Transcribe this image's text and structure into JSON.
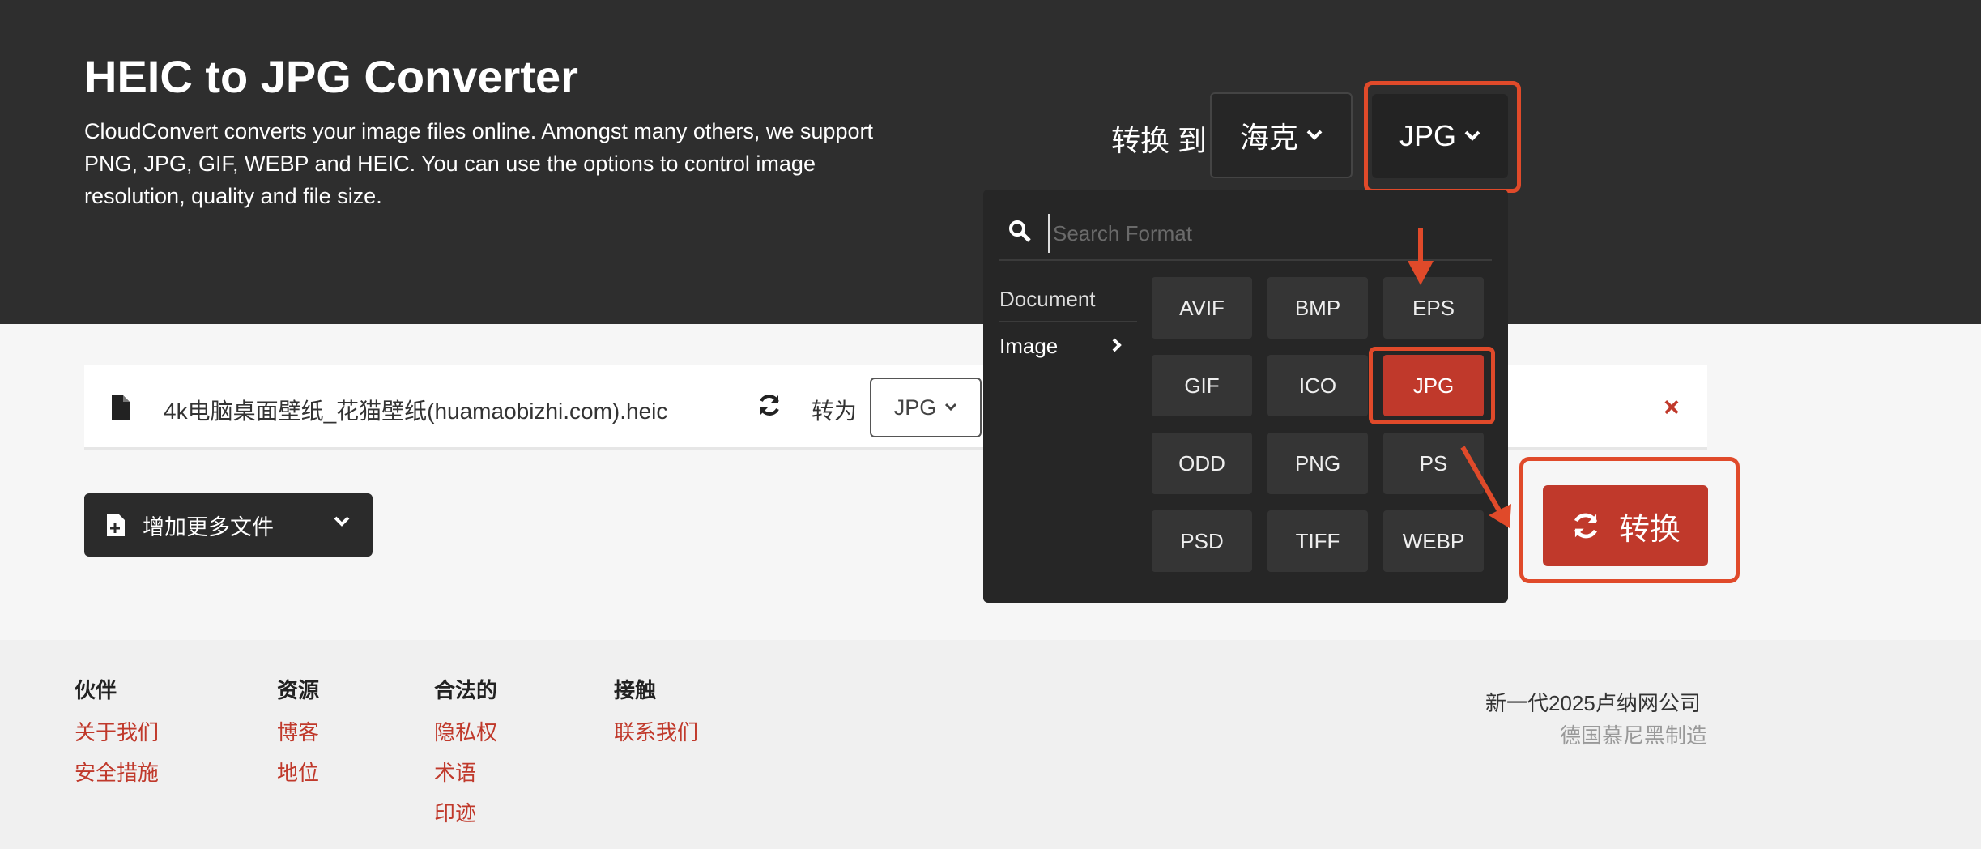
{
  "hero": {
    "title": "HEIC to JPG Converter",
    "description": "CloudConvert converts your image files online. Amongst many others, we support PNG, JPG, GIF, WEBP and HEIC. You can use the options to control image resolution, quality and file size."
  },
  "converter": {
    "convert_to_label": "转换 到",
    "source_format": "海克",
    "target_format": "JPG"
  },
  "dropdown": {
    "search_placeholder": "Search Format",
    "categories": [
      "Document",
      "Image"
    ],
    "active_category": "Image",
    "formats": [
      "AVIF",
      "BMP",
      "EPS",
      "GIF",
      "ICO",
      "JPG",
      "ODD",
      "PNG",
      "PS",
      "PSD",
      "TIFF",
      "WEBP"
    ],
    "selected_format": "JPG"
  },
  "file_row": {
    "file_name": "4k电脑桌面壁纸_花猫壁纸(huamaobizhi.com).heic",
    "convert_to_label": "转为",
    "format_value": "JPG",
    "remove_symbol": "×"
  },
  "add_files": {
    "label": "增加更多文件"
  },
  "convert_button": {
    "label": "转换"
  },
  "footer": {
    "columns": [
      {
        "heading": "伙伴",
        "links": [
          "关于我们",
          "安全措施"
        ]
      },
      {
        "heading": "资源",
        "links": [
          "博客",
          "地位"
        ]
      },
      {
        "heading": "合法的",
        "links": [
          "隐私权",
          "术语",
          "印迹"
        ]
      },
      {
        "heading": "接触",
        "links": [
          "联系我们"
        ]
      }
    ],
    "company_line": "新一代2025卢纳网公司",
    "made_in_line": "德国慕尼黑制造"
  },
  "colors": {
    "accent": "#c0392b",
    "hero_bg": "#2e2e2e",
    "annotation": "#e04a2a"
  },
  "icons": [
    "search-icon",
    "file-icon",
    "refresh-icon",
    "chevron-down-icon",
    "chevron-right-icon",
    "close-icon",
    "file-add-icon",
    "sync-icon",
    "arrow-annotation"
  ]
}
